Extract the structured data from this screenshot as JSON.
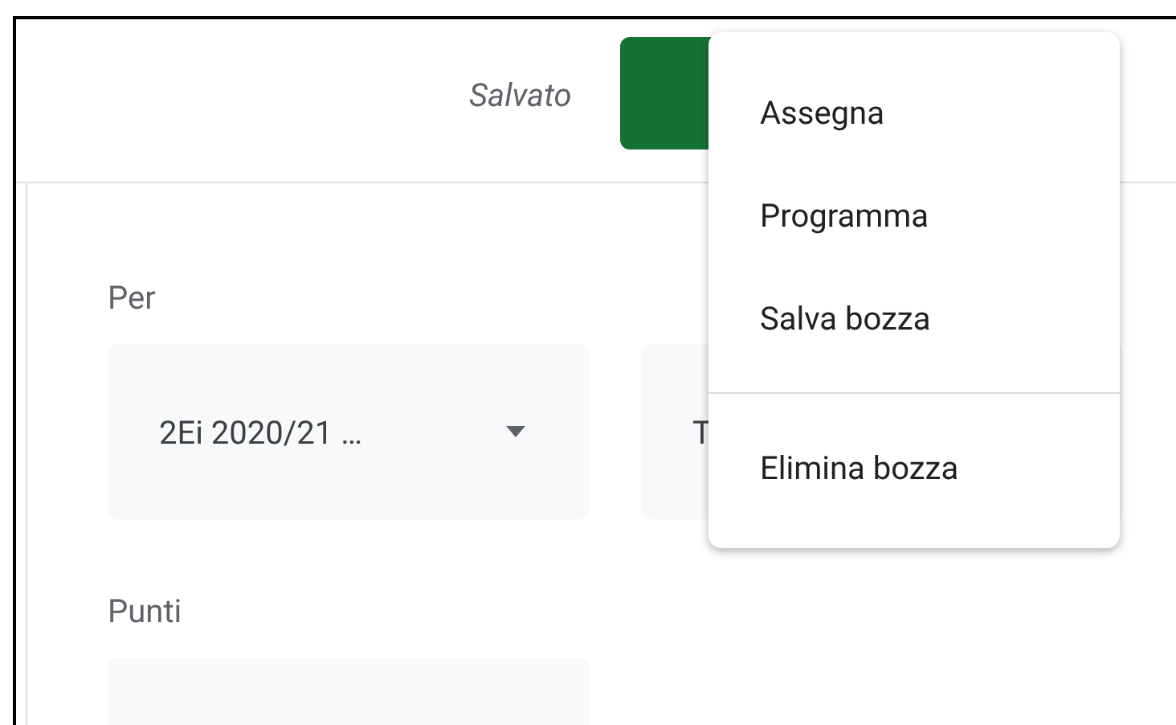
{
  "header": {
    "status": "Salvato"
  },
  "form": {
    "fields": [
      {
        "label": "Per",
        "dropdowns": [
          {
            "value": "2Ei 2020/21 …",
            "kind": "select"
          },
          {
            "value": "T",
            "kind": "text"
          }
        ]
      },
      {
        "label": "Punti",
        "dropdowns": [
          {
            "kind": "text"
          }
        ]
      }
    ]
  },
  "menu": {
    "items": [
      {
        "label": "Assegna",
        "kind": "item"
      },
      {
        "label": "Programma",
        "kind": "item"
      },
      {
        "label": "Salva bozza",
        "kind": "item"
      },
      {
        "kind": "divider"
      },
      {
        "label": "Elimina bozza",
        "kind": "item"
      }
    ]
  }
}
